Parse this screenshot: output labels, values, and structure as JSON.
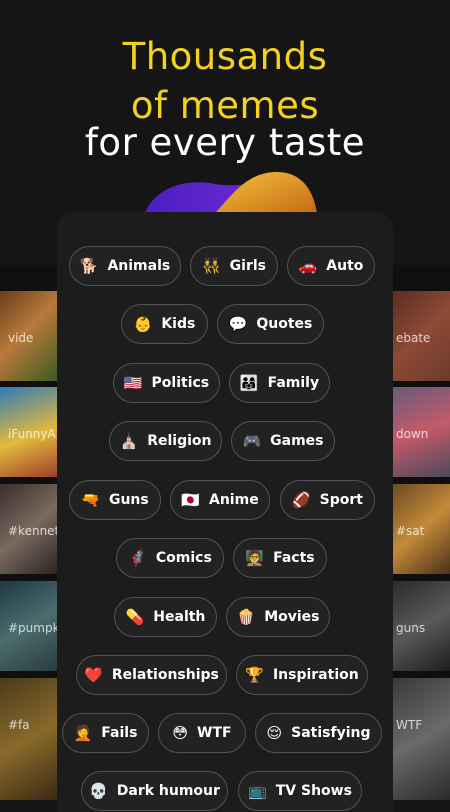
{
  "headline": {
    "line1": "Thousands",
    "line2": "of memes",
    "line3": "for every taste"
  },
  "background_tags": {
    "left": [
      "vide",
      "iFunnyA",
      "#kennet",
      "#pumpk",
      "#fa"
    ],
    "right": [
      "ebate",
      "down",
      "#sat",
      "guns",
      "WTF"
    ]
  },
  "categories": [
    {
      "emoji": "🐕",
      "label": "Animals"
    },
    {
      "emoji": "👯",
      "label": "Girls"
    },
    {
      "emoji": "🚗",
      "label": "Auto"
    },
    {
      "emoji": "👶",
      "label": "Kids"
    },
    {
      "emoji": "💬",
      "label": "Quotes"
    },
    {
      "emoji": "🇺🇸",
      "label": "Politics"
    },
    {
      "emoji": "👨‍👩‍👧",
      "label": "Family"
    },
    {
      "emoji": "⛪",
      "label": "Religion"
    },
    {
      "emoji": "🎮",
      "label": "Games"
    },
    {
      "emoji": "🔫",
      "label": "Guns"
    },
    {
      "emoji": "🇯🇵",
      "label": "Anime"
    },
    {
      "emoji": "🏈",
      "label": "Sport"
    },
    {
      "emoji": "🦸",
      "label": "Comics"
    },
    {
      "emoji": "🧑‍🏫",
      "label": "Facts"
    },
    {
      "emoji": "💊",
      "label": "Health"
    },
    {
      "emoji": "🍿",
      "label": "Movies"
    },
    {
      "emoji": "❤️",
      "label": "Relationships"
    },
    {
      "emoji": "🏆",
      "label": "Inspiration"
    },
    {
      "emoji": "🤦",
      "label": "Fails"
    },
    {
      "emoji": "😳",
      "label": "WTF"
    },
    {
      "emoji": "😌",
      "label": "Satisfying"
    },
    {
      "emoji": "💀",
      "label": "Dark humour"
    },
    {
      "emoji": "📺",
      "label": "TV Shows"
    }
  ],
  "colors": {
    "accent_yellow": "#f3d21d",
    "chip_border": "#535353",
    "panel": "#1c1c1c",
    "blob_purple": "#5b22c9",
    "blob_orange": "#e8a624"
  }
}
